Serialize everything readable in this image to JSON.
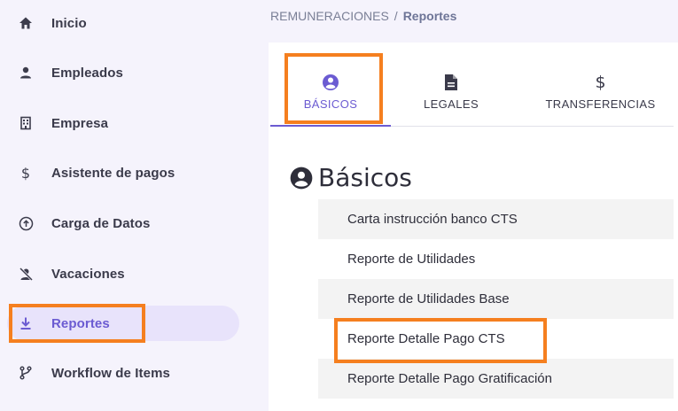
{
  "breadcrumb": {
    "section": "REMUNERACIONES",
    "separator": "/",
    "current": "Reportes"
  },
  "sidebar": {
    "items": [
      {
        "label": "Inicio",
        "icon": "home-icon"
      },
      {
        "label": "Empleados",
        "icon": "person-icon"
      },
      {
        "label": "Empresa",
        "icon": "building-icon"
      },
      {
        "label": "Asistente de pagos",
        "icon": "dollar-icon"
      },
      {
        "label": "Carga de Datos",
        "icon": "upload-circle-icon"
      },
      {
        "label": "Vacaciones",
        "icon": "person-off-icon"
      },
      {
        "label": "Reportes",
        "icon": "download-icon",
        "active": true
      },
      {
        "label": "Workflow de Items",
        "icon": "branch-icon"
      }
    ]
  },
  "tabs": [
    {
      "label": "BÁSICOS",
      "icon": "user-circle-icon",
      "active": true
    },
    {
      "label": "LEGALES",
      "icon": "document-icon"
    },
    {
      "label": "TRANSFERENCIAS",
      "icon": "dollar-icon"
    }
  ],
  "section": {
    "title": "Básicos",
    "icon": "user-circle-icon"
  },
  "reports": [
    "Carta instrucción banco CTS",
    "Reporte de Utilidades",
    "Reporte de Utilidades Base",
    "Reporte Detalle Pago CTS",
    "Reporte Detalle Pago Gratificación"
  ],
  "colors": {
    "accent": "#6b5bd2",
    "highlight": "#f57f1f",
    "sidebar_bg": "#f5f3fc",
    "active_pill": "#e8e3fb"
  }
}
